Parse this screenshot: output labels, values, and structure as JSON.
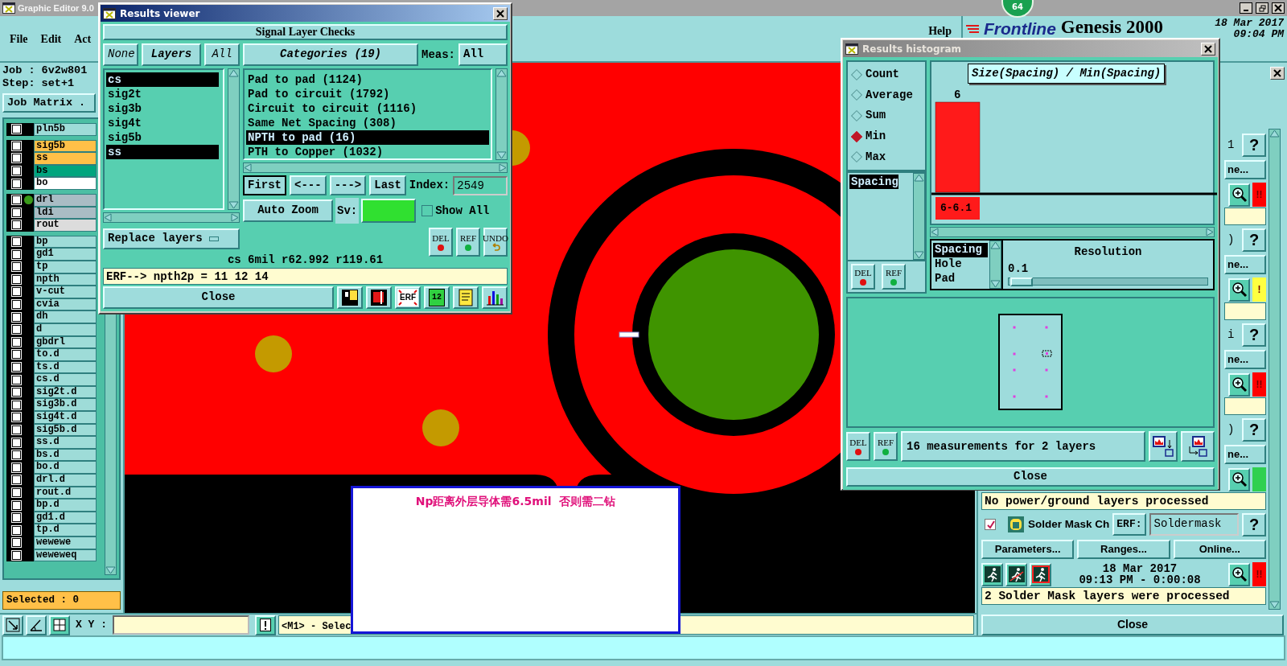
{
  "main_window": {
    "title": "Graphic Editor 9.0",
    "notification_count": "64"
  },
  "menu": [
    {
      "label": "File"
    },
    {
      "label": "Edit"
    },
    {
      "label": "Act"
    }
  ],
  "help_menu": "Help",
  "brand": {
    "logo": "Frontline",
    "product": "Genesis 2000",
    "date": "18 Mar 2017",
    "time": "09:04 PM"
  },
  "job": {
    "job": "Job : 6v2w801",
    "step": "Step: set+1",
    "matrix": "Job Matrix ."
  },
  "layer_groups": [
    [
      {
        "name": "pln5b",
        "color": "#9edcd8",
        "marked": false,
        "checked": false
      }
    ],
    [
      {
        "name": "sig5b",
        "color": "#ffc048",
        "marked": false,
        "checked": false
      },
      {
        "name": "ss",
        "color": "#ffc048",
        "marked": false,
        "checked": false
      },
      {
        "name": "bs",
        "color": "#00a57e",
        "marked": false,
        "checked": false
      },
      {
        "name": "bo",
        "color": "#ffffff",
        "marked": false,
        "checked": false
      }
    ],
    [
      {
        "name": "drl",
        "color": "#a9bcc4",
        "marked": true,
        "checked": false
      },
      {
        "name": "ldi",
        "color": "#a9bcc4",
        "marked": false,
        "checked": false
      },
      {
        "name": "rout",
        "color": "#dcdcdc",
        "marked": false,
        "checked": false
      }
    ],
    [
      {
        "name": "bp",
        "color": "#9edcd8",
        "marked": false,
        "checked": false
      },
      {
        "name": "gd1",
        "color": "#9edcd8",
        "marked": false,
        "checked": false
      },
      {
        "name": "tp",
        "color": "#9edcd8",
        "marked": false,
        "checked": false
      },
      {
        "name": "npth",
        "color": "#9edcd8",
        "marked": false,
        "checked": false
      },
      {
        "name": "v-cut",
        "color": "#9edcd8",
        "marked": false,
        "checked": false
      },
      {
        "name": "cvia",
        "color": "#9edcd8",
        "marked": false,
        "checked": false
      },
      {
        "name": "dh",
        "color": "#9edcd8",
        "marked": false,
        "checked": false
      },
      {
        "name": "d",
        "color": "#9edcd8",
        "marked": false,
        "checked": false
      },
      {
        "name": "gbdrl",
        "color": "#9edcd8",
        "marked": false,
        "checked": false
      },
      {
        "name": "to.d",
        "color": "#9edcd8",
        "marked": false,
        "checked": false
      },
      {
        "name": "ts.d",
        "color": "#9edcd8",
        "marked": false,
        "checked": false
      },
      {
        "name": "cs.d",
        "color": "#9edcd8",
        "marked": false,
        "checked": false
      },
      {
        "name": "sig2t.d",
        "color": "#9edcd8",
        "marked": false,
        "checked": false
      },
      {
        "name": "sig3b.d",
        "color": "#9edcd8",
        "marked": false,
        "checked": false
      },
      {
        "name": "sig4t.d",
        "color": "#9edcd8",
        "marked": false,
        "checked": false
      },
      {
        "name": "sig5b.d",
        "color": "#9edcd8",
        "marked": false,
        "checked": false
      },
      {
        "name": "ss.d",
        "color": "#9edcd8",
        "marked": false,
        "checked": false
      },
      {
        "name": "bs.d",
        "color": "#9edcd8",
        "marked": false,
        "checked": false
      },
      {
        "name": "bo.d",
        "color": "#9edcd8",
        "marked": false,
        "checked": false
      },
      {
        "name": "drl.d",
        "color": "#9edcd8",
        "marked": false,
        "checked": false
      },
      {
        "name": "rout.d",
        "color": "#9edcd8",
        "marked": false,
        "checked": false
      },
      {
        "name": "bp.d",
        "color": "#9edcd8",
        "marked": false,
        "checked": false
      },
      {
        "name": "gd1.d",
        "color": "#9edcd8",
        "marked": false,
        "checked": false
      },
      {
        "name": "tp.d",
        "color": "#9edcd8",
        "marked": false,
        "checked": false
      },
      {
        "name": "wewewe",
        "color": "#9edcd8",
        "marked": false,
        "checked": false
      },
      {
        "name": "weweweq",
        "color": "#9edcd8",
        "marked": false,
        "checked": false
      }
    ]
  ],
  "selected_count": "Selected : 0",
  "toolbar": {
    "xy_label": "X Y :",
    "hint": "<M1> - Selec"
  },
  "note": {
    "text": "Np距离外层导体需6.5mil  否则需二钻"
  },
  "results_viewer": {
    "title": "Results viewer",
    "header": "Signal Layer Checks",
    "layer_buttons": [
      "None",
      "Layers",
      "All"
    ],
    "layers": [
      {
        "name": "cs",
        "selected": true
      },
      {
        "name": "sig2t",
        "selected": false
      },
      {
        "name": "sig3b",
        "selected": false
      },
      {
        "name": "sig4t",
        "selected": false
      },
      {
        "name": "sig5b",
        "selected": false
      },
      {
        "name": "ss",
        "selected": true
      }
    ],
    "categories_button": "Categories (19)",
    "meas_label": "Meas:",
    "meas_value": "All",
    "categories": [
      {
        "label": "Pad to pad (1124)",
        "selected": false
      },
      {
        "label": "Pad to circuit (1792)",
        "selected": false
      },
      {
        "label": "Circuit to circuit (1116)",
        "selected": false
      },
      {
        "label": "Same Net Spacing (308)",
        "selected": false
      },
      {
        "label": "NPTH to pad (16)",
        "selected": true
      },
      {
        "label": "PTH to Copper (1032)",
        "selected": false
      }
    ],
    "nav": [
      "First",
      "<---",
      "--->",
      "Last"
    ],
    "index_label": "Index:",
    "index_value": "2549",
    "zoom_mode": "Auto Zoom",
    "sv_label": "Sv:",
    "show_all": {
      "label": "Show All",
      "checked": false
    },
    "replace_mode": "Replace layers",
    "actions": [
      {
        "kind": "del",
        "label": "DEL"
      },
      {
        "kind": "ref",
        "label": "REF"
      },
      {
        "kind": "undo",
        "label": "UNDO"
      }
    ],
    "info": "cs  6mil   r62.992   r119.61",
    "erf": "ERF--> npth2p = 11 12 14",
    "close": "Close",
    "tools": [
      {
        "kind": "split"
      },
      {
        "kind": "marker"
      },
      {
        "kind": "erf",
        "label": "ERF"
      },
      {
        "kind": "counter",
        "label": "12"
      },
      {
        "kind": "notes"
      },
      {
        "kind": "chart"
      }
    ]
  },
  "histogram": {
    "title": "Results histogram",
    "modes": [
      {
        "label": "Count",
        "selected": false
      },
      {
        "label": "Average",
        "selected": false
      },
      {
        "label": "Sum",
        "selected": false
      },
      {
        "label": "Min",
        "selected": true
      },
      {
        "label": "Max",
        "selected": false
      }
    ],
    "fields": [
      {
        "label": "Spacing",
        "selected": true
      }
    ],
    "list_actions": [
      {
        "kind": "del",
        "label": "DEL"
      },
      {
        "kind": "ref",
        "label": "REF"
      }
    ],
    "chart": {
      "title": "Size(Spacing) / Min(Spacing)",
      "bars": [
        {
          "label": "6",
          "range": "6-6.1"
        }
      ]
    },
    "measures": [
      {
        "label": "Spacing",
        "selected": true
      },
      {
        "label": "Hole",
        "selected": false
      },
      {
        "label": "Pad",
        "selected": false
      }
    ],
    "resolution_label": "Resolution",
    "resolution_value": "0.1",
    "resolution_slider": {
      "level": 0.01
    },
    "actions": [
      {
        "kind": "del",
        "label": "DEL"
      },
      {
        "kind": "ref",
        "label": "REF"
      }
    ],
    "summary": "16 measurements for 2 layers",
    "close": "Close"
  },
  "checks_panel": {
    "checks": [
      {
        "kind": "partial",
        "fragment": "1",
        "help": "?",
        "button_tail": "ne...",
        "color": "#ff0000",
        "flag": "!!"
      },
      {
        "kind": "partial",
        "fragment": ")",
        "help": "?",
        "button_tail": "ne...",
        "color": "#ffff40",
        "flag": "!"
      },
      {
        "kind": "partial",
        "fragment": "i",
        "help": "?",
        "button_tail": "ne...",
        "color": "#ff0000",
        "flag": "!!"
      },
      {
        "kind": "partial",
        "fragment": ")",
        "help": "?",
        "button_tail": "ne...",
        "color": "#30d050",
        "message": "No power/ground layers processed"
      },
      {
        "kind": "full",
        "enabled": true,
        "name": "Solder Mask Ch",
        "erf_label": "ERF:",
        "erf_value": "Soldermask",
        "help": "?",
        "buttons": [
          "Parameters...",
          "Ranges...",
          "Online..."
        ],
        "date": "18 Mar 2017",
        "time": "09:13 PM - 0:00:08",
        "color": "#ff0000",
        "flag": "!!",
        "message": "2 Solder Mask layers were processed"
      }
    ],
    "close": "Close"
  }
}
